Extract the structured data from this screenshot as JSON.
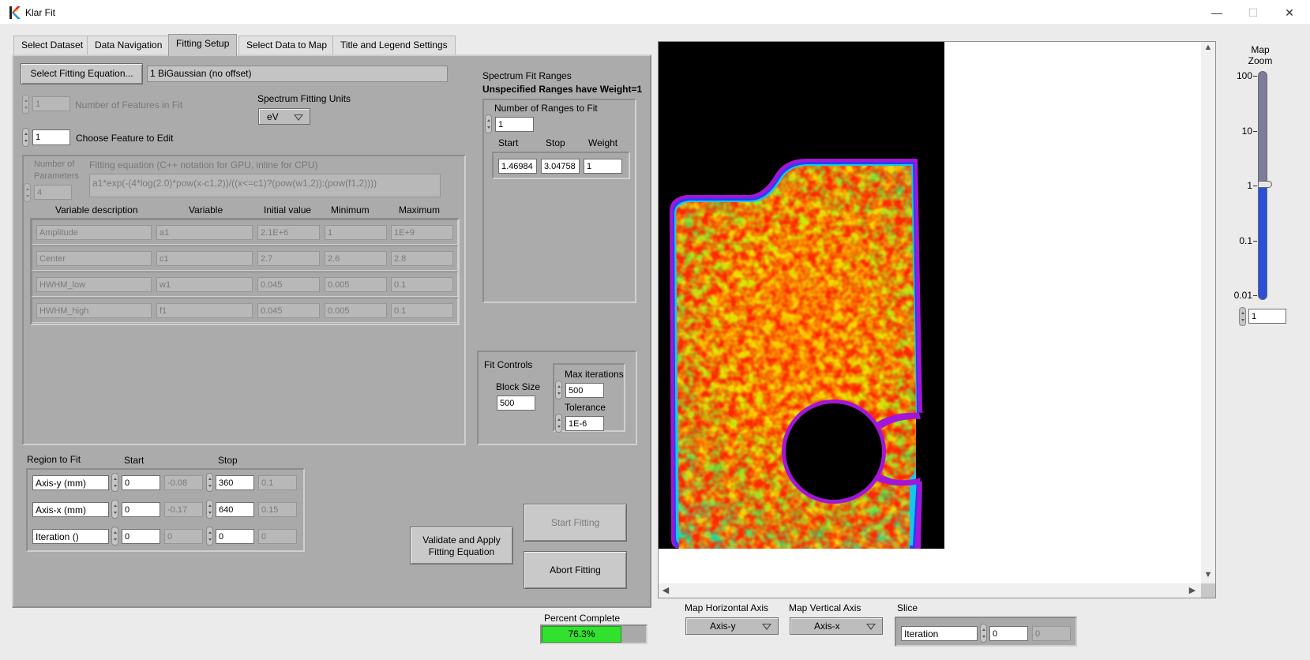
{
  "window": {
    "title": "Klar Fit",
    "minimize": "—",
    "maximize": "☐",
    "close": "✕"
  },
  "tabs": [
    "Select Dataset",
    "Data Navigation",
    "Fitting Setup",
    "Select Data to Map",
    "Title and Legend Settings"
  ],
  "fitting": {
    "select_eq_button": "Select Fitting Equation...",
    "equation_name": "1 BiGaussian (no offset)",
    "num_features_value": "1",
    "num_features_label": "Number of Features in Fit",
    "units_label": "Spectrum Fitting Units",
    "units_value": "eV",
    "feature_edit_value": "1",
    "feature_edit_label": "Choose Feature to Edit",
    "num_params_label1": "Number of",
    "num_params_label2": "Parameters",
    "num_params_value": "4",
    "eq_label": "Fitting equation (C++ notation for GPU, inline for CPU)",
    "equation": "a1*exp(-(4*log(2.0)*pow(x-c1,2))/((x<=c1)?(pow(w1,2)):(pow(f1,2))))",
    "columns": [
      "Variable description",
      "Variable",
      "Initial value",
      "Minimum",
      "Maximum"
    ],
    "rows": [
      {
        "desc": "Amplitude",
        "var": "a1",
        "init": "2.1E+6",
        "min": "1",
        "max": "1E+9"
      },
      {
        "desc": "Center",
        "var": "c1",
        "init": "2.7",
        "min": "2.6",
        "max": "2.8"
      },
      {
        "desc": "HWHM_low",
        "var": "w1",
        "init": "0.045",
        "min": "0.005",
        "max": "0.1"
      },
      {
        "desc": "HWHM_high",
        "var": "f1",
        "init": "0.045",
        "min": "0.005",
        "max": "0.1"
      }
    ]
  },
  "ranges": {
    "title": "Spectrum Fit Ranges",
    "subtitle": "Unspecified Ranges have Weight=1",
    "count_label": "Number of Ranges to Fit",
    "count_value": "1",
    "col_start": "Start",
    "col_stop": "Stop",
    "col_weight": "Weight",
    "start": "1.46984",
    "stop": "3.04758",
    "weight": "1"
  },
  "fit_controls": {
    "title": "Fit Controls",
    "block_label": "Block Size",
    "block_value": "500",
    "maxit_label": "Max iterations",
    "maxit_value": "500",
    "tol_label": "Tolerance",
    "tol_value": "1E-6"
  },
  "region": {
    "title": "Region to Fit",
    "col_start": "Start",
    "col_stop": "Stop",
    "rows": [
      {
        "axis": "Axis-y (mm)",
        "start": "0",
        "start_v": "-0.08",
        "stop": "360",
        "stop_v": "0.1"
      },
      {
        "axis": "Axis-x (mm)",
        "start": "0",
        "start_v": "-0.17",
        "stop": "640",
        "stop_v": "0.15"
      },
      {
        "axis": "Iteration ()",
        "start": "0",
        "start_v": "0",
        "stop": "0",
        "stop_v": "0"
      }
    ]
  },
  "buttons": {
    "validate1": "Validate and Apply",
    "validate2": "Fitting Equation",
    "start": "Start Fitting",
    "abort": "Abort Fitting"
  },
  "progress": {
    "label": "Percent Complete",
    "value": "76.3%",
    "fraction": 0.763
  },
  "map_controls": {
    "h_label": "Map Horizontal Axis",
    "h_value": "Axis-y",
    "v_label": "Map Vertical Axis",
    "v_value": "Axis-x",
    "slice_label": "Slice",
    "slice_axis": "Iteration",
    "slice_value": "0",
    "slice_value2": "0"
  },
  "zoom": {
    "label1": "Map",
    "label2": "Zoom",
    "ticks": [
      "100",
      "10",
      "1",
      "0.1",
      "0.01"
    ],
    "value": "1"
  },
  "colors": {
    "panel": "#ababab",
    "progress_fill": "#32e02e",
    "zoom_fill": "#2a4fd8"
  }
}
